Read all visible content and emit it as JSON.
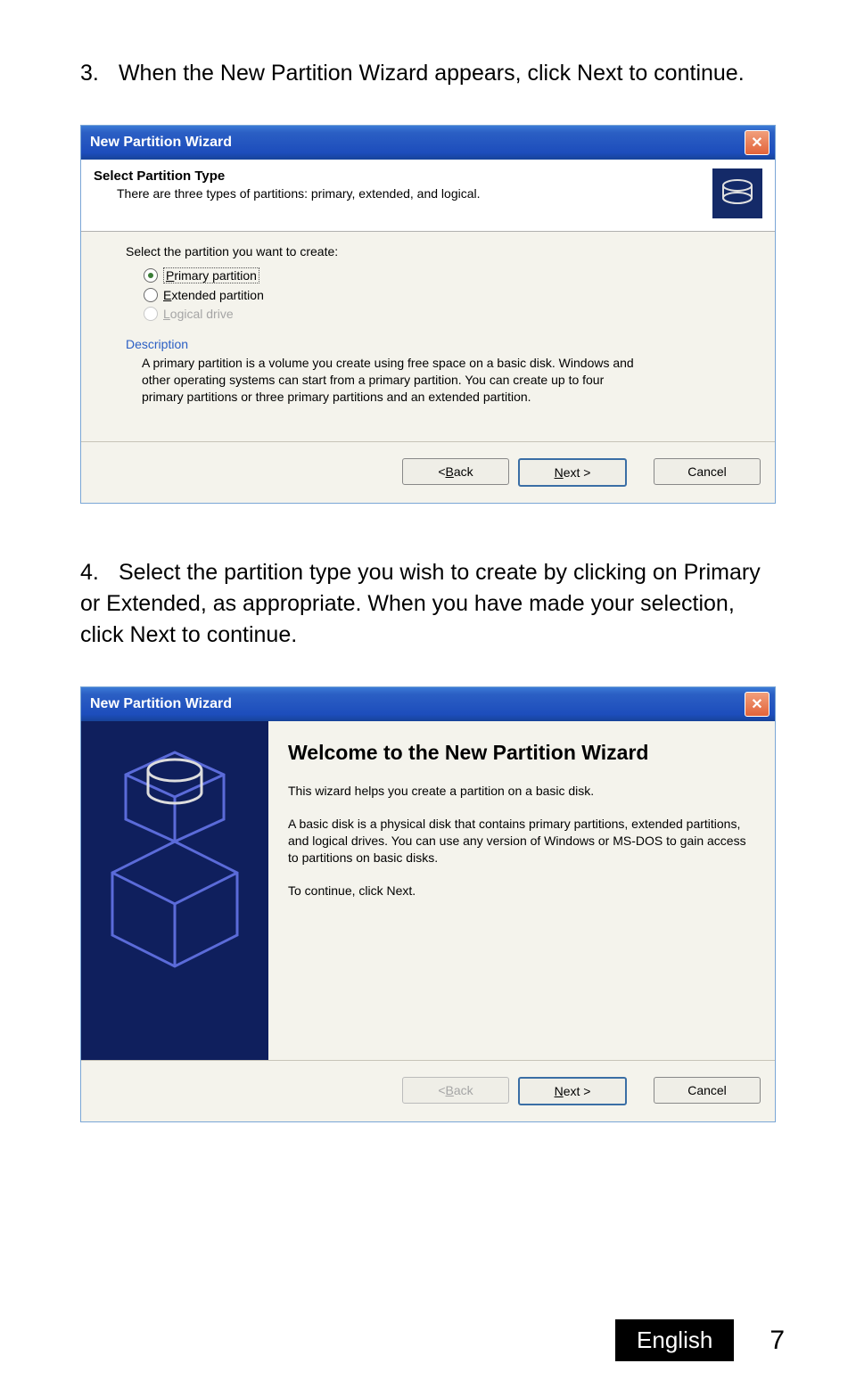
{
  "step3": {
    "num": "3.",
    "text": "When the New Partition Wizard appears, click Next to continue."
  },
  "step4": {
    "num": "4.",
    "text": "Select the partition type you wish to create by clicking on Primary or Extended, as appropriate. When you have made your selection, click Next to continue."
  },
  "dialog1": {
    "title": "New Partition Wizard",
    "header_title": "Select Partition Type",
    "header_sub": "There are three types of partitions: primary, extended, and logical.",
    "prompt": "Select the partition you want to create:",
    "radio1_u": "P",
    "radio1_rest": "rimary partition",
    "radio2_u": "E",
    "radio2_rest": "xtended partition",
    "radio3_u": "L",
    "radio3_rest": "ogical drive",
    "desc_label": "Description",
    "desc_text": "A primary partition is a volume you create using free space on a basic disk. Windows and other operating systems can start from a primary partition. You can create up to four primary partitions or three primary partitions and an extended partition.",
    "back_pre": "< ",
    "back_u": "B",
    "back_post": "ack",
    "next_u": "N",
    "next_post": "ext >",
    "cancel": "Cancel"
  },
  "dialog2": {
    "title": "New Partition Wizard",
    "welcome_title": "Welcome to the New Partition Wizard",
    "p1": "This wizard helps you create a partition on a basic disk.",
    "p2": "A basic disk is a physical disk that contains primary partitions, extended partitions, and logical drives. You can use any version of Windows or MS-DOS to gain access to partitions on basic disks.",
    "p3": "To continue, click Next.",
    "back_pre": "< ",
    "back_u": "B",
    "back_post": "ack",
    "next_u": "N",
    "next_post": "ext >",
    "cancel": "Cancel"
  },
  "footer": {
    "lang": "English",
    "page": "7"
  }
}
